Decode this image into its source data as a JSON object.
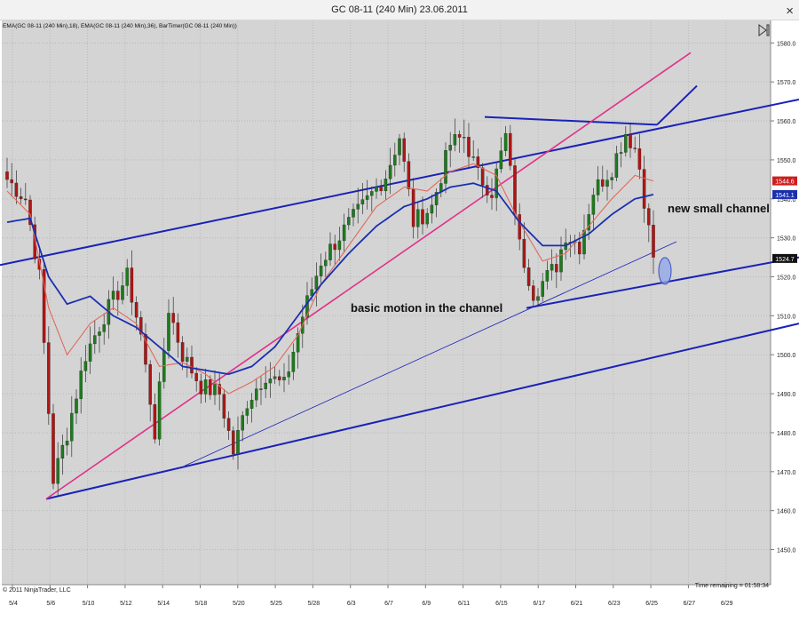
{
  "window": {
    "title": "GC 08-11 (240 Min)  23.06.2011",
    "close_glyph": "×"
  },
  "indicator_header": "EMA(GC 08-11 (240 Min),18), EMA(GC 08-11 (240 Min),36), BarTimer(GC 08-11 (240 Min))",
  "copyright": "© 2011 NinjaTrader, LLC",
  "time_remaining": "Time remaining = 01:58:34",
  "colors": {
    "plot_bg": "#d4d4d4",
    "grid": "#b9b9b9",
    "up_candle": "#1e7a1e",
    "down_candle": "#b01515",
    "ema_fast": "#e06a5a",
    "ema_slow": "#1a2fb0",
    "channel": "#1a22b8",
    "magenta": "#e0308a",
    "highlight": "#8fa6e8"
  },
  "chart_data": {
    "type": "candlestick",
    "instrument": "GC 08-11",
    "interval": "240 Min",
    "ylim": [
      1441,
      1586
    ],
    "y_ticks": [
      1450.0,
      1460.0,
      1470.0,
      1480.0,
      1490.0,
      1500.0,
      1510.0,
      1520.0,
      1530.0,
      1540.0,
      1550.0,
      1560.0,
      1570.0,
      1580.0
    ],
    "x_tick_labels": [
      "5/4",
      "5/6",
      "5/10",
      "5/12",
      "5/14",
      "5/18",
      "5/20",
      "5/25",
      "5/28",
      "6/3",
      "6/7",
      "6/9",
      "6/11",
      "6/15",
      "6/17",
      "6/21",
      "6/23",
      "6/25",
      "6/27",
      "6/29"
    ],
    "price_tags": [
      {
        "value": 1544.6,
        "label": "1544.6",
        "color": "#cc1f1f"
      },
      {
        "value": 1541.1,
        "label": "1541.1",
        "color": "#1a2fb0"
      },
      {
        "value": 1524.7,
        "label": "1524.7",
        "color": "#111111"
      }
    ],
    "candles_keypoints": [
      [
        0,
        1545
      ],
      [
        4,
        1540
      ],
      [
        7,
        1520
      ],
      [
        10,
        1468
      ],
      [
        13,
        1480
      ],
      [
        17,
        1500
      ],
      [
        21,
        1510
      ],
      [
        26,
        1520
      ],
      [
        29,
        1505
      ],
      [
        32,
        1480
      ],
      [
        35,
        1512
      ],
      [
        38,
        1500
      ],
      [
        42,
        1492
      ],
      [
        46,
        1490
      ],
      [
        49,
        1475
      ],
      [
        52,
        1488
      ],
      [
        56,
        1495
      ],
      [
        60,
        1492
      ],
      [
        64,
        1510
      ],
      [
        68,
        1524
      ],
      [
        73,
        1532
      ],
      [
        77,
        1538
      ],
      [
        82,
        1546
      ],
      [
        85,
        1556
      ],
      [
        88,
        1534
      ],
      [
        92,
        1538
      ],
      [
        96,
        1554
      ],
      [
        99,
        1556
      ],
      [
        102,
        1546
      ],
      [
        105,
        1542
      ],
      [
        108,
        1556
      ],
      [
        111,
        1528
      ],
      [
        114,
        1516
      ],
      [
        117,
        1520
      ],
      [
        119,
        1523
      ],
      [
        121,
        1531
      ],
      [
        124,
        1528
      ],
      [
        127,
        1542
      ],
      [
        131,
        1548
      ],
      [
        134,
        1557
      ],
      [
        136,
        1553
      ],
      [
        137,
        1548
      ],
      [
        139,
        1532
      ],
      [
        140,
        1525
      ]
    ],
    "ema_fast_keypoints": [
      [
        0,
        1542
      ],
      [
        5,
        1536
      ],
      [
        9,
        1512
      ],
      [
        13,
        1500
      ],
      [
        18,
        1508
      ],
      [
        23,
        1512
      ],
      [
        28,
        1508
      ],
      [
        33,
        1497
      ],
      [
        38,
        1498
      ],
      [
        43,
        1495
      ],
      [
        48,
        1490
      ],
      [
        53,
        1493
      ],
      [
        58,
        1497
      ],
      [
        63,
        1505
      ],
      [
        68,
        1518
      ],
      [
        74,
        1528
      ],
      [
        80,
        1538
      ],
      [
        86,
        1543
      ],
      [
        91,
        1542
      ],
      [
        96,
        1547
      ],
      [
        101,
        1549
      ],
      [
        106,
        1546
      ],
      [
        111,
        1534
      ],
      [
        116,
        1524
      ],
      [
        121,
        1526
      ],
      [
        126,
        1533
      ],
      [
        131,
        1540
      ],
      [
        136,
        1546
      ],
      [
        140,
        1544.6
      ]
    ],
    "ema_slow_keypoints": [
      [
        0,
        1534
      ],
      [
        5,
        1535
      ],
      [
        9,
        1520
      ],
      [
        13,
        1513
      ],
      [
        18,
        1515
      ],
      [
        23,
        1510
      ],
      [
        28,
        1507
      ],
      [
        33,
        1502
      ],
      [
        38,
        1497
      ],
      [
        43,
        1496
      ],
      [
        48,
        1495
      ],
      [
        53,
        1497
      ],
      [
        58,
        1502
      ],
      [
        63,
        1510
      ],
      [
        68,
        1518
      ],
      [
        74,
        1526
      ],
      [
        80,
        1533
      ],
      [
        86,
        1538
      ],
      [
        91,
        1540
      ],
      [
        96,
        1543
      ],
      [
        101,
        1544
      ],
      [
        106,
        1542
      ],
      [
        111,
        1534
      ],
      [
        116,
        1528
      ],
      [
        121,
        1528
      ],
      [
        126,
        1531
      ],
      [
        131,
        1536
      ],
      [
        136,
        1540
      ],
      [
        140,
        1541.1
      ]
    ],
    "annotations": [
      {
        "text": "basic motion in the channel"
      },
      {
        "text": "new small channel"
      }
    ],
    "grid": true,
    "legend": "none"
  }
}
